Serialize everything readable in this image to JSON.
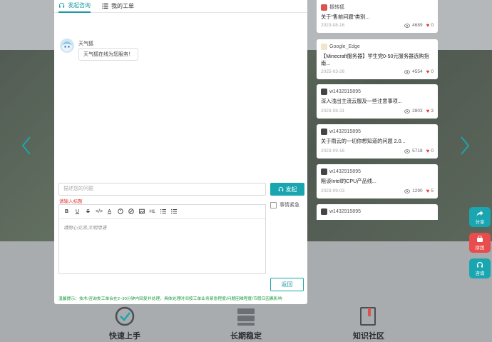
{
  "dialog": {
    "tabs": [
      {
        "label": "发起咨询",
        "icon": "headset-icon",
        "active": true
      },
      {
        "label": "我的工单",
        "icon": "list-icon",
        "active": false
      }
    ],
    "bot": {
      "name": "天气狐",
      "message": "天气狐在线为您服务！"
    },
    "title_input": {
      "placeholder": "描述您的问题",
      "error": "请输入标题"
    },
    "send_label": "发起",
    "urgent_label": "事情紧急",
    "editor": {
      "placeholder": "请耐心交流,文明用语",
      "toolbar": [
        "B",
        "U",
        "S",
        "</>",
        "A",
        "palette",
        "link",
        "image",
        "H1",
        "ordered-list",
        "unordered-list"
      ]
    },
    "return_label": "返回",
    "tip": "温馨提示：技术/咨询类工单会在2~30分钟内回复并处理，具体处理时间按工单业务紧急程度/问题困难程度/节假日因素影响"
  },
  "cards": [
    {
      "author": "振转狐",
      "title": "关于“售前问题”类别...",
      "date": "2023-08-16",
      "views": "4689",
      "likes": "0"
    },
    {
      "author": "Google_Edge",
      "title": "【Minecraft服务器】学生党0-50元服务器选购指南...",
      "date": "2025-03-26",
      "views": "4554",
      "likes": "0"
    },
    {
      "author": "w1432915895",
      "title": "深入浅出主流云服及一些注意事项...",
      "date": "2023-08-31",
      "views": "2803",
      "likes": "3"
    },
    {
      "author": "w1432915895",
      "title": "关于雨云的一切你想知道的问题 2.0...",
      "date": "2023-09-16",
      "views": "5718",
      "likes": "0"
    },
    {
      "author": "w1432915895",
      "title": "粗谈Intel的CPU产品线...",
      "date": "2023-09-03",
      "views": "1290",
      "likes": "5"
    },
    {
      "author": "w1432915895",
      "title": "",
      "date": "",
      "views": "",
      "likes": ""
    }
  ],
  "side_buttons": [
    {
      "label": "分享",
      "icon": "share-icon",
      "color": "#1aa6b0"
    },
    {
      "label": "拼团",
      "icon": "group-buy-icon",
      "color": "#e84c4c"
    },
    {
      "label": "咨询",
      "icon": "headset-icon",
      "color": "#1aa6b0"
    }
  ],
  "features": [
    {
      "label": "快速上手",
      "icon": "check-circle-icon"
    },
    {
      "label": "长期稳定",
      "icon": "server-icon"
    },
    {
      "label": "知识社区",
      "icon": "book-icon"
    }
  ],
  "colors": {
    "accent": "#1aa6b0",
    "danger": "#e53935",
    "tip": "#1a9a3f"
  }
}
